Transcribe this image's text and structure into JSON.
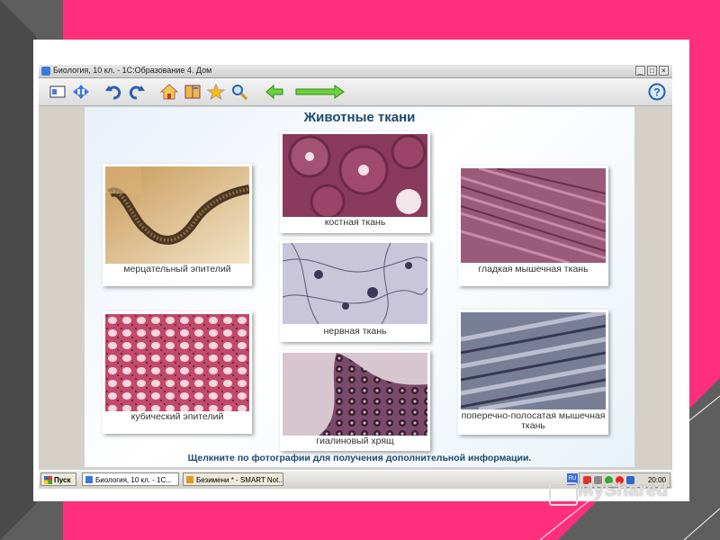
{
  "window": {
    "title": "Биология, 10 кл. - 1С:Образование 4. Дом",
    "controls": [
      "_",
      "□",
      "×"
    ]
  },
  "toolbar": {
    "icons": [
      "content-icon",
      "navigate-icon",
      "undo-icon",
      "redo-icon",
      "home-icon",
      "book-icon",
      "star-icon",
      "search-icon",
      "back-arrow-icon",
      "forward-arrow-icon",
      "help-icon"
    ],
    "help_label": "?"
  },
  "slide": {
    "title": "Животные ткани",
    "footer": "Щелкните по фотографии для получения дополнительной информации.",
    "cards": [
      {
        "caption": "мерцательный эпителий"
      },
      {
        "caption": "костная ткань"
      },
      {
        "caption": "гладкая мышечная ткань"
      },
      {
        "caption": "нервная ткань"
      },
      {
        "caption": "кубический эпителий"
      },
      {
        "caption": "поперечно-полосатая мышечная ткань"
      },
      {
        "caption": "гиалиновый хрящ"
      }
    ]
  },
  "taskbar": {
    "start_label": "Пуск",
    "tasks": [
      "Биология, 10 кл. - 1С...",
      "Безимени * - SMART Not..."
    ],
    "lang": "RU",
    "clock": "20:00"
  },
  "brand": {
    "name": "MyShared"
  },
  "colors": {
    "background": "#ff2f7c",
    "heading": "#1f4a6d",
    "frame_gray": "#5a5a5a"
  }
}
